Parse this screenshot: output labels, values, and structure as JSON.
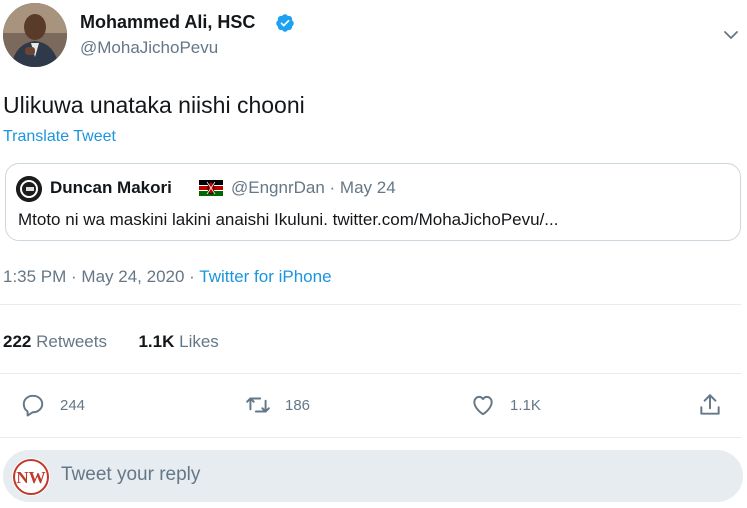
{
  "author": {
    "name": "Mohammed Ali, HSC",
    "handle": "@MohaJichoPevu",
    "verified": true
  },
  "tweet": {
    "text": "Ulikuwa unataka niishi chooni",
    "translate_label": "Translate Tweet",
    "time": "1:35 PM",
    "date": "May 24, 2020",
    "source": "Twitter for iPhone"
  },
  "quoted": {
    "name": "Duncan Makori",
    "handle_date": "@EngnrDan · May 24",
    "text": "Mtoto ni wa maskini lakini anaishi Ikuluni. twitter.com/MohaJichoPevu/..."
  },
  "stats": {
    "retweets_count": "222",
    "retweets_label": "Retweets",
    "likes_count": "1.1K",
    "likes_label": "Likes"
  },
  "actions": {
    "reply_count": "244",
    "retweet_count": "186",
    "like_count": "1.1K"
  },
  "reply": {
    "placeholder": "Tweet your reply",
    "avatar_text": "NW"
  },
  "colors": {
    "accent": "#1b95e0",
    "muted": "#657786",
    "divider": "#e6ecf0"
  },
  "icons": [
    "verified-badge-icon",
    "chevron-down-icon",
    "kenya-flag-icon",
    "reply-icon",
    "retweet-icon",
    "like-icon",
    "share-icon"
  ]
}
